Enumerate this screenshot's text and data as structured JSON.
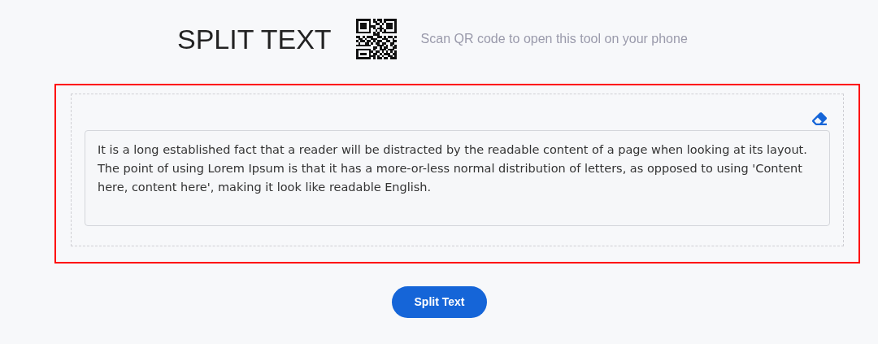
{
  "header": {
    "title": "SPLIT TEXT",
    "qr_caption": "Scan QR code to open this tool on your phone"
  },
  "editor": {
    "highlighted": true,
    "value": "It is a long established fact that a reader will be distracted by the readable content of a page when looking at its layout. The point of using Lorem Ipsum is that it has a more-or-less normal distribution of letters, as opposed to using 'Content here, content here', making it look like readable English."
  },
  "button": {
    "label": "Split Text"
  }
}
